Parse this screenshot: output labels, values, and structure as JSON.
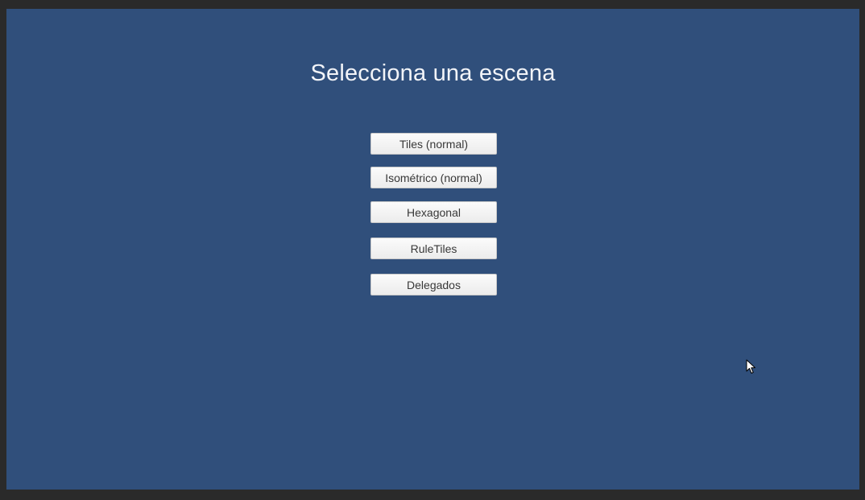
{
  "scene": {
    "title": "Selecciona una escena",
    "buttons": [
      {
        "label": "Tiles (normal)"
      },
      {
        "label": "Isométrico (normal)"
      },
      {
        "label": "Hexagonal"
      },
      {
        "label": "RuleTiles"
      },
      {
        "label": "Delegados"
      }
    ]
  },
  "colors": {
    "background": "#304f7b",
    "frame": "#2a2a2a",
    "button": "#f1f1f1",
    "title_text": "#f2f4f8"
  },
  "icons": {
    "pointer": "mouse-pointer-icon"
  }
}
